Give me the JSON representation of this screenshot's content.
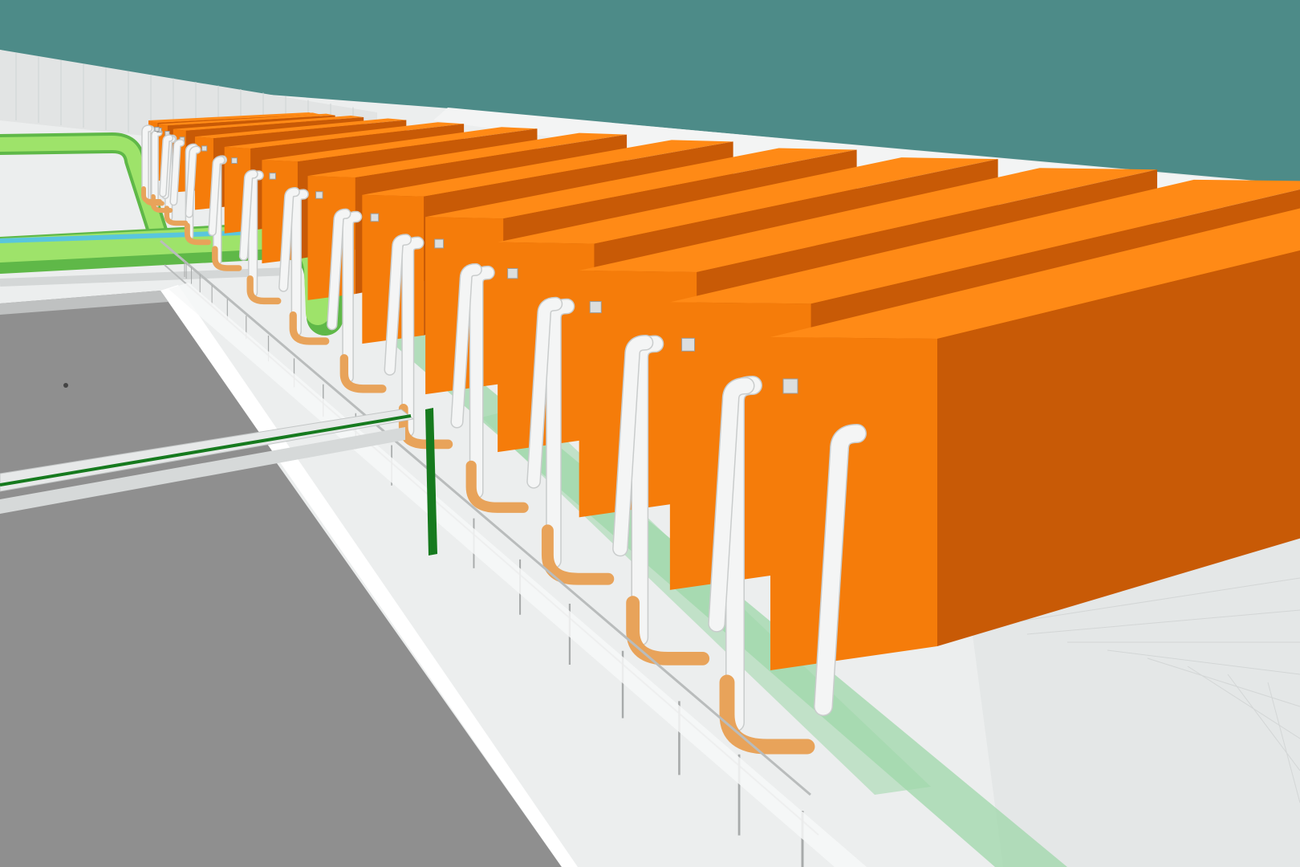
{
  "scene": {
    "type": "3d-plant-model-render",
    "colors": {
      "sky": "#4d8b88",
      "ground": "#eceeee",
      "ground_shadow": "#dfe2e2",
      "basin": "#8f8f8f",
      "basin_dark": "#7b7b7b",
      "unit_top": "#ff8a16",
      "unit_front": "#f57c0a",
      "unit_side": "#c85a06",
      "pipe_white": "#f4f5f5",
      "pipe_shade": "#c9cccc",
      "pipe_copper": "#e8a35a",
      "pipe_green": "#9ee36a",
      "pipe_green_dark": "#5fb848",
      "walkway_green": "#9fd7a9",
      "beam_green": "#167a1e",
      "rail": "#b9bcbc"
    },
    "unit_count": 14,
    "labels": []
  }
}
